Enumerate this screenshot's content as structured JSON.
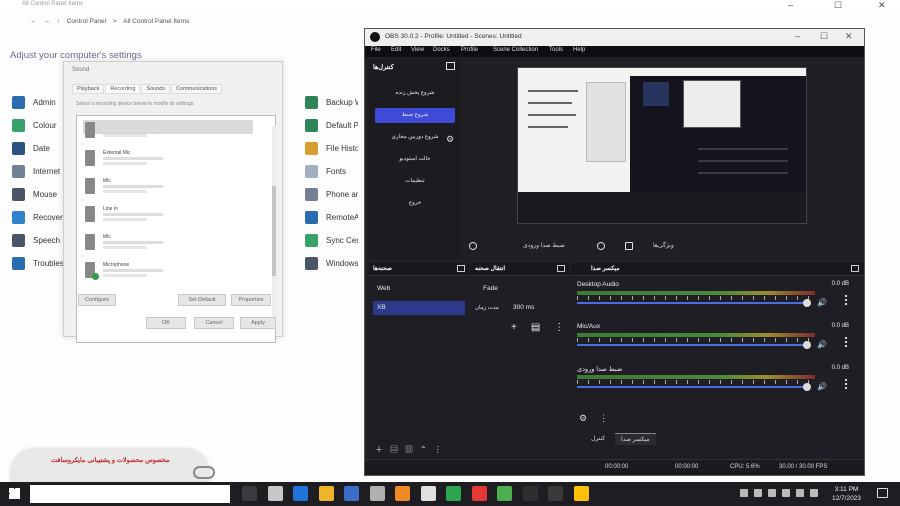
{
  "control_panel": {
    "title": "All Control Panel Items",
    "address": [
      "Control Panel",
      ">",
      "All Control Panel Items"
    ],
    "adjust_text": "Adjust your computer's settings",
    "left_items": [
      {
        "label": "Admin",
        "color": "#2b6cb0"
      },
      {
        "label": "Colour",
        "color": "#38a169"
      },
      {
        "label": "Date",
        "color": "#2c5282"
      },
      {
        "label": "Internet",
        "color": "#718096"
      },
      {
        "label": "Mouse",
        "color": "#4a5568"
      },
      {
        "label": "Recovery",
        "color": "#3182ce"
      },
      {
        "label": "Speech",
        "color": "#4a5568"
      },
      {
        "label": "Troubleshooting",
        "color": "#2b6cb0"
      }
    ],
    "right_items": [
      {
        "label": "Backup Windows",
        "color": "#2f855a"
      },
      {
        "label": "Default Programs",
        "color": "#2f855a"
      },
      {
        "label": "File History",
        "color": "#d69e2e"
      },
      {
        "label": "Fonts",
        "color": "#a0aec0"
      },
      {
        "label": "Phone and Modem",
        "color": "#718096"
      },
      {
        "label": "RemoteApp Connections",
        "color": "#2b6cb0"
      },
      {
        "label": "Sync Center",
        "color": "#38a169"
      },
      {
        "label": "Windows Defender",
        "color": "#4a5568"
      }
    ]
  },
  "sound_dialog": {
    "title": "Sound",
    "tabs": [
      "Playback",
      "Recording",
      "Sounds",
      "Communications"
    ],
    "hint": "Select a recording device below to modify its settings:",
    "devices": [
      {
        "name": "",
        "ok": false
      },
      {
        "name": "External Mic",
        "ok": false
      },
      {
        "name": "Mic",
        "ok": false
      },
      {
        "name": "Line In",
        "ok": false
      },
      {
        "name": "Mic",
        "ok": false
      },
      {
        "name": "Microphone",
        "ok": true
      }
    ],
    "buttons": {
      "configure": "Configure",
      "set_default": "Set Default",
      "properties": "Properties",
      "ok": "OK",
      "cancel": "Cancel",
      "apply": "Apply"
    }
  },
  "toast": {
    "text": "مخصوص محصولات و پشتیبانی‌ مایکروسافت"
  },
  "obs": {
    "title": "OBS 30.0.2 - Profile: Untitled - Scenes: Untitled",
    "menu": [
      "File",
      "Edit",
      "View",
      "Docks",
      "Profile",
      "Scene Collection",
      "Tools",
      "Help"
    ],
    "sidebar_header": "کنترل‌ها",
    "sidebar_items": [
      "شروع پخش زنده",
      "شروع ضبط",
      "شروع دوربین مجازی",
      "حالت استودیو",
      "تنظیمات",
      "خروج"
    ],
    "controls": {
      "audio_capture": "ضبط صدا ورودی",
      "filters": "فیلترها",
      "properties": "ویژگی‌ها"
    },
    "scenes": {
      "header": "صحنه‌ها",
      "items": [
        "Web",
        "XB"
      ]
    },
    "transitions": {
      "header": "انتقال صحنه",
      "items": [
        "Fade",
        "300 ms",
        "مدت زمان"
      ]
    },
    "mixer": {
      "header": "میکسر صدا",
      "channels": [
        {
          "name": "Desktop Audio",
          "db": "0.0 dB"
        },
        {
          "name": "Mic/Aux",
          "db": "0.0 dB"
        },
        {
          "name": "ضبط صدا ورودی",
          "db": "0.0 dB"
        }
      ],
      "tabs": [
        "کنترل",
        "میکسر صدا"
      ]
    },
    "status": {
      "rec_time": "00:00:00",
      "stream_time": "00:00:00",
      "cpu": "CPU: 5.6%",
      "fps": "30.00 / 30.00 FPS"
    }
  },
  "taskbar": {
    "time": "3:11 PM",
    "date": "12/7/2023",
    "apps": [
      "#3a3a40",
      "#c8c8c8",
      "#1f73d8",
      "#f0b429",
      "#3a6ec8",
      "#b0b0b0",
      "#f08a24",
      "#e0e0e0",
      "#2da44e",
      "#e53935",
      "#4caf50",
      "#2e2e2e",
      "#3a3a3a",
      "#ffc107"
    ]
  }
}
